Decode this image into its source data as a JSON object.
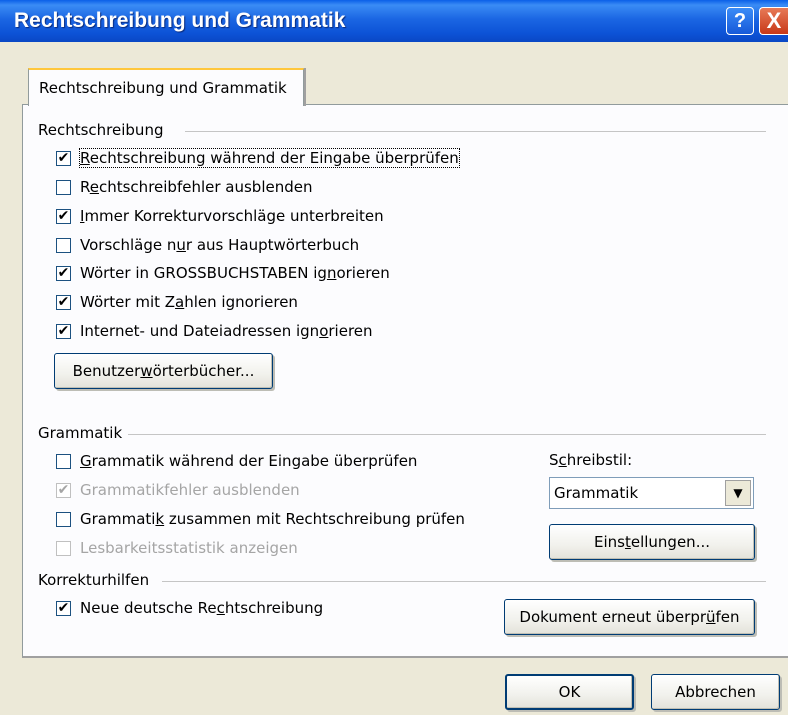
{
  "window": {
    "title": "Rechtschreibung und Grammatik"
  },
  "titlebar": {
    "help_glyph": "?",
    "close_glyph": "X"
  },
  "tab": {
    "label": "Rechtschreibung und Grammatik"
  },
  "spelling": {
    "heading": "Rechtschreibung",
    "options": [
      {
        "pre": "",
        "u": "R",
        "post": "echtschreibung während der Eingabe überprüfen",
        "checked": true,
        "disabled": false
      },
      {
        "pre": "R",
        "u": "e",
        "post": "chtschreibfehler ausblenden",
        "checked": false,
        "disabled": false
      },
      {
        "pre": "",
        "u": "I",
        "post": "mmer Korrekturvorschläge unterbreiten",
        "checked": true,
        "disabled": false
      },
      {
        "pre": "Vorschläge n",
        "u": "u",
        "post": "r aus Hauptwörterbuch",
        "checked": false,
        "disabled": false
      },
      {
        "pre": "Wörter in GROSSBUCHSTABEN ig",
        "u": "n",
        "post": "orieren",
        "checked": true,
        "disabled": false
      },
      {
        "pre": "Wörter mit Z",
        "u": "a",
        "post": "hlen ignorieren",
        "checked": true,
        "disabled": false
      },
      {
        "pre": "Internet- und Dateiadressen ign",
        "u": "o",
        "post": "rieren",
        "checked": true,
        "disabled": false
      }
    ],
    "dictionaries_button": {
      "pre": "Benutzer",
      "u": "w",
      "post": "örterbücher..."
    }
  },
  "grammar": {
    "heading": "Grammatik",
    "options": [
      {
        "pre": "",
        "u": "G",
        "post": "rammatik während der Eingabe überprüfen",
        "checked": false,
        "disabled": false
      },
      {
        "pre": "",
        "u": "",
        "post": "Grammatikfehler ausblenden",
        "checked": true,
        "disabled": true
      },
      {
        "pre": "Grammati",
        "u": "k",
        "post": " zusammen mit Rechtschreibung prüfen",
        "checked": false,
        "disabled": false
      },
      {
        "pre": "",
        "u": "",
        "post": "Lesbarkeitsstatistik anzeigen",
        "checked": false,
        "disabled": true
      }
    ],
    "style_label": {
      "pre": "S",
      "u": "c",
      "post": "hreibstil:"
    },
    "style_value": "Grammatik",
    "settings_button": {
      "pre": "Eins",
      "u": "t",
      "post": "ellungen..."
    }
  },
  "proofing": {
    "heading": "Korrekturhilfen",
    "option": {
      "pre": "Neue deutsche Re",
      "u": "c",
      "post": "htschreibung",
      "checked": true
    },
    "recheck_button": {
      "pre": "Dokument erneut überpr",
      "u": "ü",
      "post": "fen"
    }
  },
  "footer": {
    "ok_label": "OK",
    "cancel_label": "Abbrechen"
  }
}
